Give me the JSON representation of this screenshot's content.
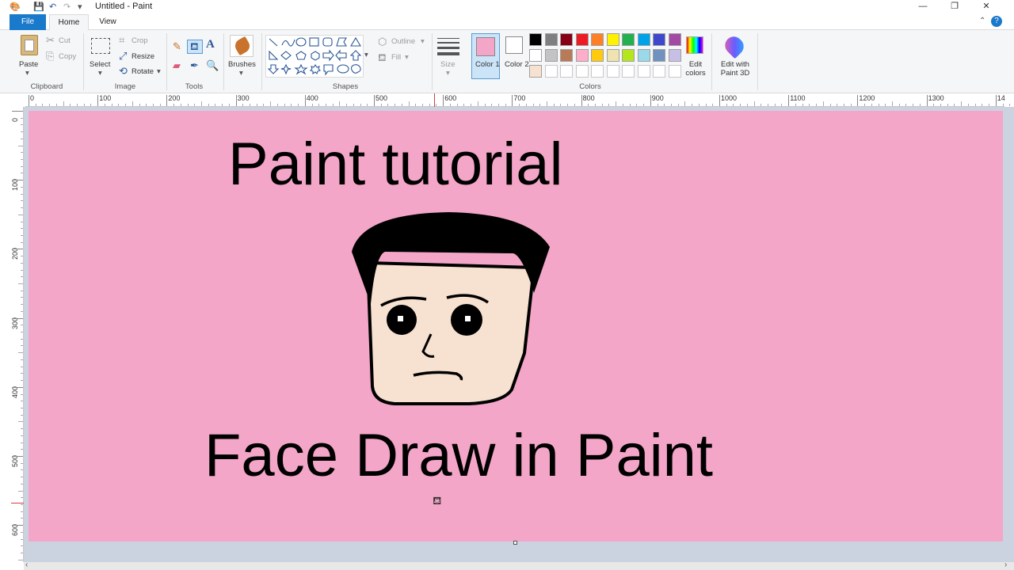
{
  "window": {
    "title": "Untitled - Paint",
    "controls": [
      "—",
      "❐",
      "✕"
    ]
  },
  "tabs": [
    "File",
    "Home",
    "View"
  ],
  "ribbon": {
    "clipboard": {
      "label": "Clipboard",
      "paste": "Paste",
      "cut": "Cut",
      "copy": "Copy"
    },
    "image": {
      "label": "Image",
      "select": "Select",
      "crop": "Crop",
      "resize": "Resize",
      "rotate": "Rotate"
    },
    "tools": {
      "label": "Tools"
    },
    "brushes": {
      "label": "Brushes"
    },
    "shapes": {
      "label": "Shapes",
      "outline": "Outline",
      "fill": "Fill"
    },
    "size": {
      "label": "Size"
    },
    "colors": {
      "label": "Colors",
      "color1": "Color 1",
      "color2": "Color 2",
      "edit": "Edit colors",
      "color1_value": "#f4a6c8",
      "color2_value": "#ffffff",
      "palette_row1": [
        "#000000",
        "#7f7f7f",
        "#880015",
        "#ed1c24",
        "#ff7f27",
        "#fff200",
        "#22b14c",
        "#00a2e8",
        "#3f48cc",
        "#a349a4"
      ],
      "palette_row2": [
        "#ffffff",
        "#c3c3c3",
        "#b97a57",
        "#ffaec9",
        "#ffc90e",
        "#efe4b0",
        "#b5e61d",
        "#99d9ea",
        "#7092be",
        "#c8bfe7"
      ],
      "palette_row3_first": "#f7e1d0"
    },
    "paint3d": {
      "label": "Edit with Paint 3D"
    }
  },
  "ruler": {
    "h_marks": [
      "0",
      "100",
      "200",
      "300",
      "400",
      "500",
      "600",
      "700",
      "800",
      "900",
      "1000",
      "1100",
      "1200",
      "1300",
      "14"
    ],
    "v_marks": [
      "0",
      "100",
      "200",
      "300",
      "400",
      "500",
      "600"
    ]
  },
  "canvas": {
    "background": "#f4a6c8",
    "headline": "Paint tutorial",
    "caption": "Face Draw in Paint"
  }
}
